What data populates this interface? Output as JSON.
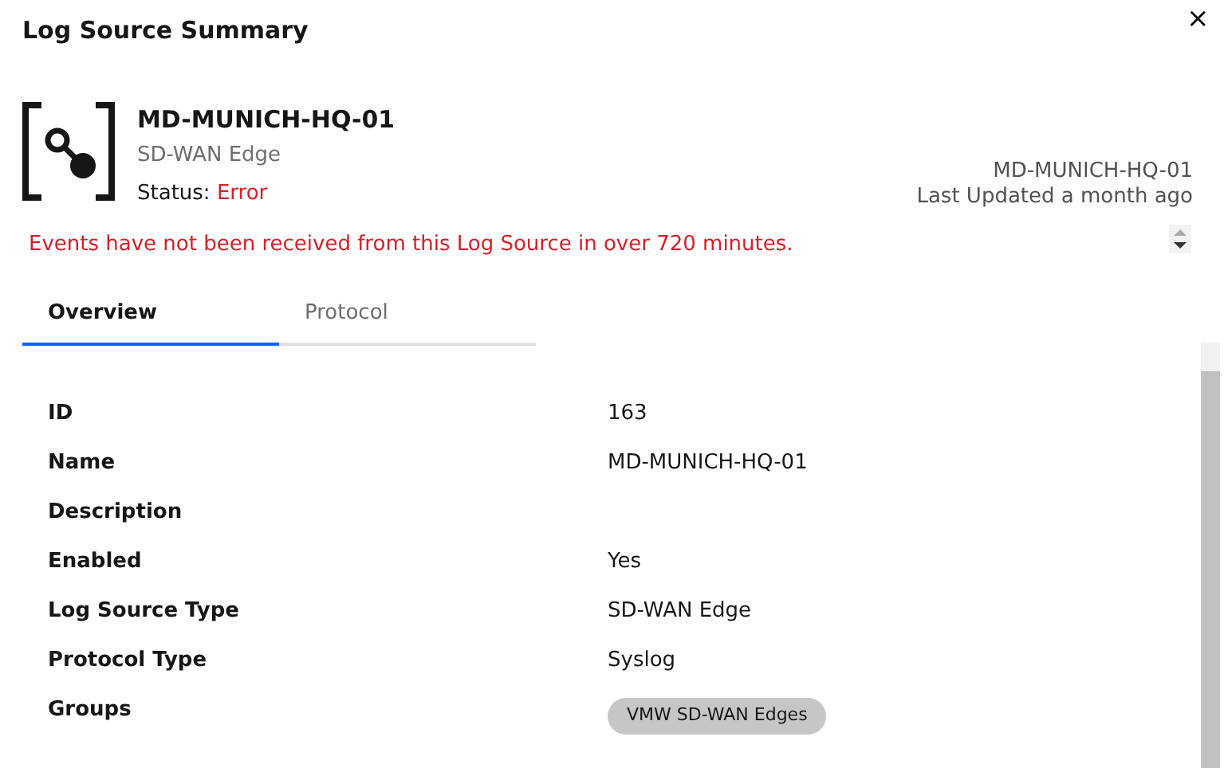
{
  "window": {
    "title": "Log Source Summary",
    "close": "×"
  },
  "header": {
    "name": "MD-MUNICH-HQ-01",
    "type": "SD-WAN Edge",
    "status_label": "Status:",
    "status": "Error"
  },
  "meta": {
    "name": "MD-MUNICH-HQ-01",
    "updated": "Last Updated a month ago"
  },
  "error_message": "Events have not been received from this Log Source in over 720 minutes.",
  "tabs": [
    {
      "label": "Overview",
      "selected": true
    },
    {
      "label": "Protocol",
      "selected": false
    }
  ],
  "details": [
    {
      "label": "ID",
      "kind": "text",
      "value": "163"
    },
    {
      "label": "Name",
      "kind": "text",
      "value": "MD-MUNICH-HQ-01"
    },
    {
      "label": "Description"
    },
    {
      "label": "Enabled",
      "kind": "text",
      "value": "Yes"
    },
    {
      "label": "Log Source Type",
      "kind": "text",
      "value": "SD-WAN Edge"
    },
    {
      "label": "Protocol Type",
      "kind": "text",
      "value": "Syslog"
    },
    {
      "label": "Groups",
      "kind": "tag",
      "value": "VMW SD-WAN Edges"
    }
  ]
}
